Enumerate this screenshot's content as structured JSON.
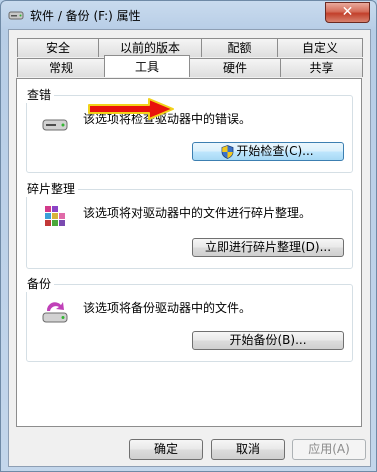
{
  "window": {
    "title": "软件 / 备份 (F:) 属性",
    "close_label": "✕"
  },
  "tabs_row1": [
    "安全",
    "以前的版本",
    "配额",
    "自定义"
  ],
  "tabs_row2": [
    "常规",
    "工具",
    "硬件",
    "共享"
  ],
  "active_tab": "工具",
  "sections": {
    "check": {
      "title": "查错",
      "description": "该选项将检查驱动器中的错误。",
      "button": "开始检查(C)..."
    },
    "defrag": {
      "title": "碎片整理",
      "description": "该选项将对驱动器中的文件进行碎片整理。",
      "button": "立即进行碎片整理(D)..."
    },
    "backup": {
      "title": "备份",
      "description": "该选项将备份驱动器中的文件。",
      "button": "开始备份(B)..."
    }
  },
  "footer": {
    "ok": "确定",
    "cancel": "取消",
    "apply": "应用(A)"
  },
  "colors": {
    "arrow_fill": "#e8120c",
    "arrow_outline": "#f2d21a"
  }
}
